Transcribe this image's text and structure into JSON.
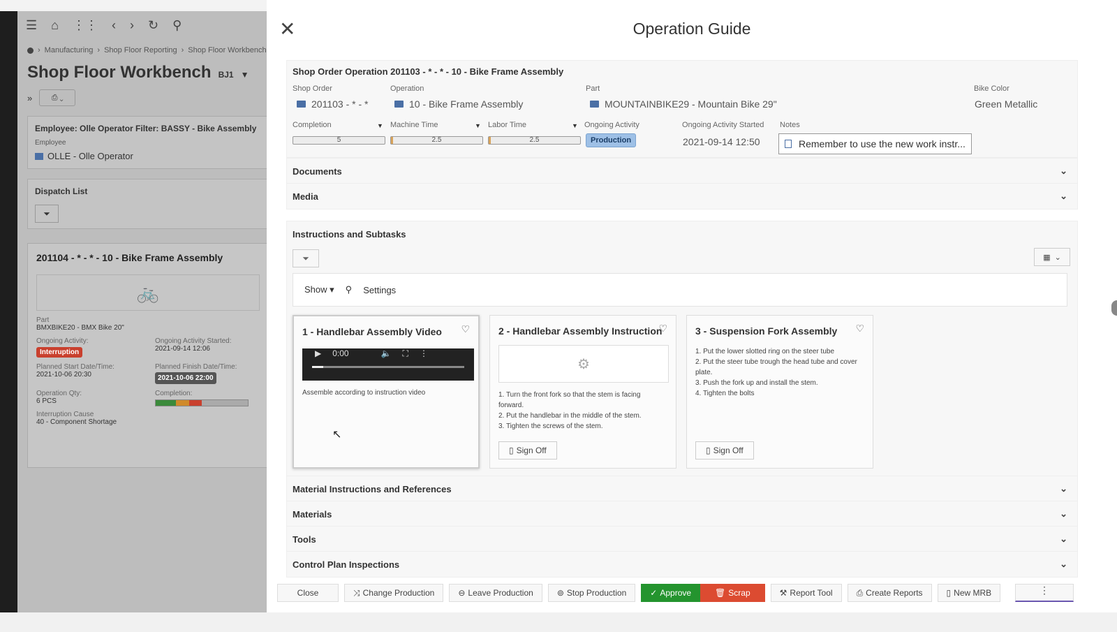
{
  "background": {
    "breadcrumb": [
      "Manufacturing",
      "Shop Floor Reporting",
      "Shop Floor Workbench"
    ],
    "title": "Shop Floor Workbench",
    "title_suffix": "BJ1",
    "employee_card": {
      "heading": "Employee: Olle Operator Filter: BASSY - Bike Assembly",
      "employee_label": "Employee",
      "employee_value": "OLLE - Olle Operator"
    },
    "dispatch_list_label": "Dispatch List",
    "work_order": {
      "title": "201104 - * - * - 10 - Bike Frame Assembly",
      "part_label": "Part",
      "part_value": "BMXBIKE20 - BMX Bike 20\"",
      "ongoing_activity_label": "Ongoing Activity:",
      "ongoing_activity_value": "Interruption",
      "ongoing_started_label": "Ongoing Activity Started:",
      "ongoing_started_value": "2021-09-14 12:06",
      "planned_start_label": "Planned Start Date/Time:",
      "planned_start_value": "2021-10-06 20:30",
      "planned_finish_label": "Planned Finish Date/Time:",
      "planned_finish_value": "2021-10-06 22:00",
      "qty_label": "Operation Qty:",
      "qty_value": "6 PCS",
      "completion_label": "Completion:",
      "interruption_label": "Interruption Cause",
      "interruption_value": "40 - Component Shortage"
    }
  },
  "panel": {
    "title": "Operation Guide",
    "header_card": {
      "heading": "Shop Order Operation 201103 - * - * - 10 - Bike Frame Assembly",
      "shop_order_label": "Shop Order",
      "shop_order_value": "201103 - * - *",
      "operation_label": "Operation",
      "operation_value": "10 - Bike Frame Assembly",
      "part_label": "Part",
      "part_value": "MOUNTAINBIKE29 - Mountain Bike 29\"",
      "bike_color_label": "Bike Color",
      "bike_color_value": "Green Metallic",
      "completion_label": "Completion",
      "completion_value": "5",
      "machine_time_label": "Machine Time",
      "machine_time_value": "2.5",
      "labor_time_label": "Labor Time",
      "labor_time_value": "2.5",
      "ongoing_activity_label": "Ongoing Activity",
      "ongoing_activity_value": "Production",
      "ongoing_started_label": "Ongoing Activity Started",
      "ongoing_started_value": "2021-09-14 12:50",
      "notes_label": "Notes",
      "notes_value": "Remember to use the new work instr..."
    },
    "sections": {
      "documents": "Documents",
      "media": "Media",
      "instructions": "Instructions and Subtasks",
      "material_instructions": "Material Instructions and References",
      "materials": "Materials",
      "tools": "Tools",
      "control_plan": "Control Plan Inspections"
    },
    "search": {
      "show_label": "Show",
      "settings_label": "Settings"
    },
    "cards": [
      {
        "title": "1 - Handlebar Assembly Video",
        "video_time": "0:00",
        "text": "Assemble according to instruction video"
      },
      {
        "title": "2 - Handlebar Assembly Instruction",
        "steps": [
          "1. Turn the front fork so that the stem is facing forward.",
          "2. Put the handlebar in the middle of the stem.",
          "3. Tighten the screws of the stem."
        ],
        "signoff": "Sign Off"
      },
      {
        "title": "3 - Suspension Fork Assembly",
        "steps": [
          "1. Put the lower slotted ring on the steer tube",
          "2. Put the steer tube trough the head tube and cover plate.",
          "3. Push the fork up and install the stem.",
          "4. Tighten the bolts"
        ],
        "signoff": "Sign Off"
      }
    ],
    "buttons": {
      "close": "Close",
      "change_production": "Change Production",
      "leave_production": "Leave Production",
      "stop_production": "Stop Production",
      "approve": "Approve",
      "scrap": "Scrap",
      "report_tool": "Report Tool",
      "create_reports": "Create Reports",
      "new_mrb": "New MRB"
    }
  },
  "colors": {
    "approve": "#24942e",
    "scrap": "#dc4b31",
    "production_badge": "#9ec0e6",
    "interruption_badge": "#c9402e"
  }
}
